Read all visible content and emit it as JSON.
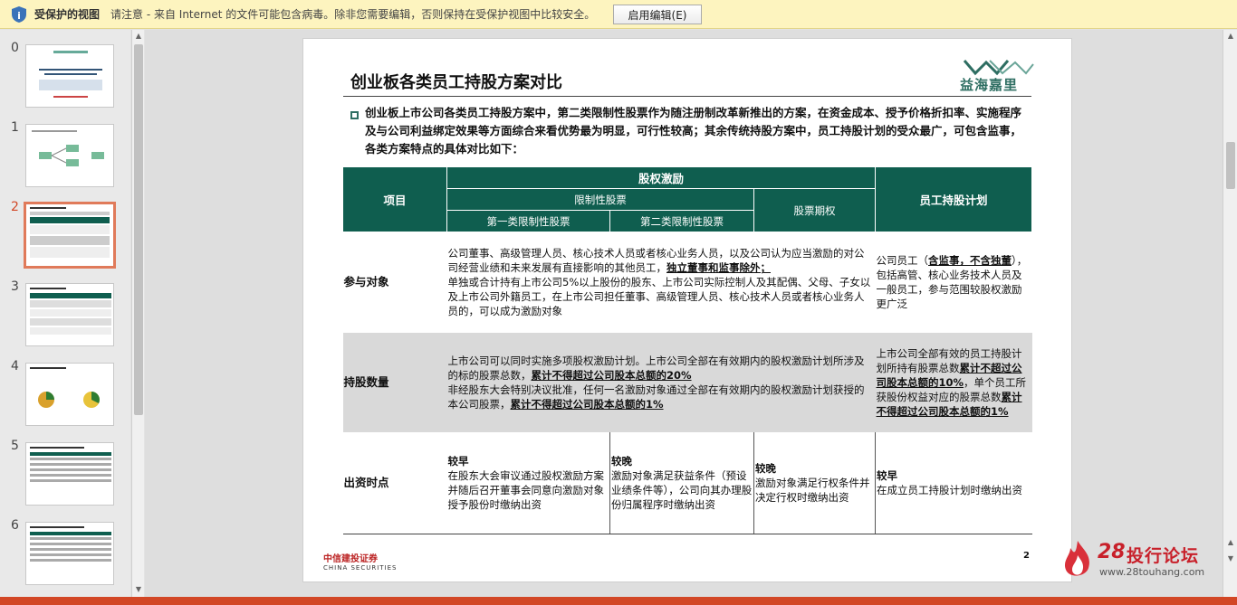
{
  "banner": {
    "title": "受保护的视图",
    "message": "请注意 - 来自 Internet 的文件可能包含病毒。除非您需要编辑，否则保持在受保护视图中比较安全。",
    "enable_button": "启用编辑(E)"
  },
  "thumbnails": [
    {
      "num": "0"
    },
    {
      "num": "1"
    },
    {
      "num": "2"
    },
    {
      "num": "3"
    },
    {
      "num": "4"
    },
    {
      "num": "5"
    },
    {
      "num": "6"
    }
  ],
  "slide": {
    "title": "创业板各类员工持股方案对比",
    "logo_text": "益海嘉里",
    "intro": "创业板上市公司各类员工持股方案中，第二类限制性股票作为随注册制改革新推出的方案，在资金成本、授予价格折扣率、实施程序及与公司利益绑定效果等方面综合来看优势最为明显，可行性较高；其余传统持股方案中，员工持股计划的受众最广，可包含监事，各类方案特点的具体对比如下：",
    "table": {
      "h_item": "项目",
      "h_equity": "股权激励",
      "h_restricted": "限制性股票",
      "h_type1": "第一类限制性股票",
      "h_type2": "第二类限制性股票",
      "h_option": "股票期权",
      "h_esop": "员工持股计划",
      "r1_head": "参与对象",
      "r1_a1": "公司董事、高级管理人员、核心技术人员或者核心业务人员，以及公司认为应当激励的对公司经营业绩和未来发展有直接影响的其他员工，",
      "r1_a2": "独立董事和监事除外；",
      "r1_a3": "单独或合计持有上市公司5%以上股份的股东、上市公司实际控制人及其配偶、父母、子女以及上市公司外籍员工，在上市公司担任董事、高级管理人员、核心技术人员或者核心业务人员的，可以成为激励对象",
      "r1_e1": "公司员工（",
      "r1_e2": "含监事，不含独董",
      "r1_e3": "），包括高管、核心业务技术人员及一般员工，参与范围较股权激励更广泛",
      "r2_head": "持股数量",
      "r2_a1": "上市公司可以同时实施多项股权激励计划。上市公司全部在有效期内的股权激励计划所涉及的标的股票总数，",
      "r2_a2": "累计不得超过公司股本总额的20%",
      "r2_a3": "非经股东大会特别决议批准，任何一名激励对象通过全部在有效期内的股权激励计划获授的本公司股票，",
      "r2_a4": "累计不得超过公司股本总额的1%",
      "r2_e1": "上市公司全部有效的员工持股计划所持有股票总数",
      "r2_e2": "累计不超过公司股本总额的10%",
      "r2_e3": "，单个员工所获股份权益对应的股票总数",
      "r2_e4": "累计不得超过公司股本总额的1%",
      "r3_head": "出资时点",
      "r3_t1_b": "较早",
      "r3_t1": "在股东大会审议通过股权激励方案并随后召开董事会同意向激励对象授予股份时缴纳出资",
      "r3_t2_b": "较晚",
      "r3_t2": "激励对象满足获益条件（预设业绩条件等），公司向其办理股份归属程序时缴纳出资",
      "r3_t3_b": "较晚",
      "r3_t3": "激励对象满足行权条件并决定行权时缴纳出资",
      "r3_t4_b": "较早",
      "r3_t4": "在成立员工持股计划时缴纳出资"
    },
    "footer_company": "中信建投证券",
    "footer_company_en": "CHINA SECURITIES",
    "page_number": "2"
  },
  "watermark": {
    "num": "28",
    "text": "投行论坛",
    "url": "www.28touhang.com"
  },
  "colors": {
    "accent": "#0f5e4f",
    "banner_bg": "#fdf4bf",
    "status_bar": "#d24726"
  }
}
